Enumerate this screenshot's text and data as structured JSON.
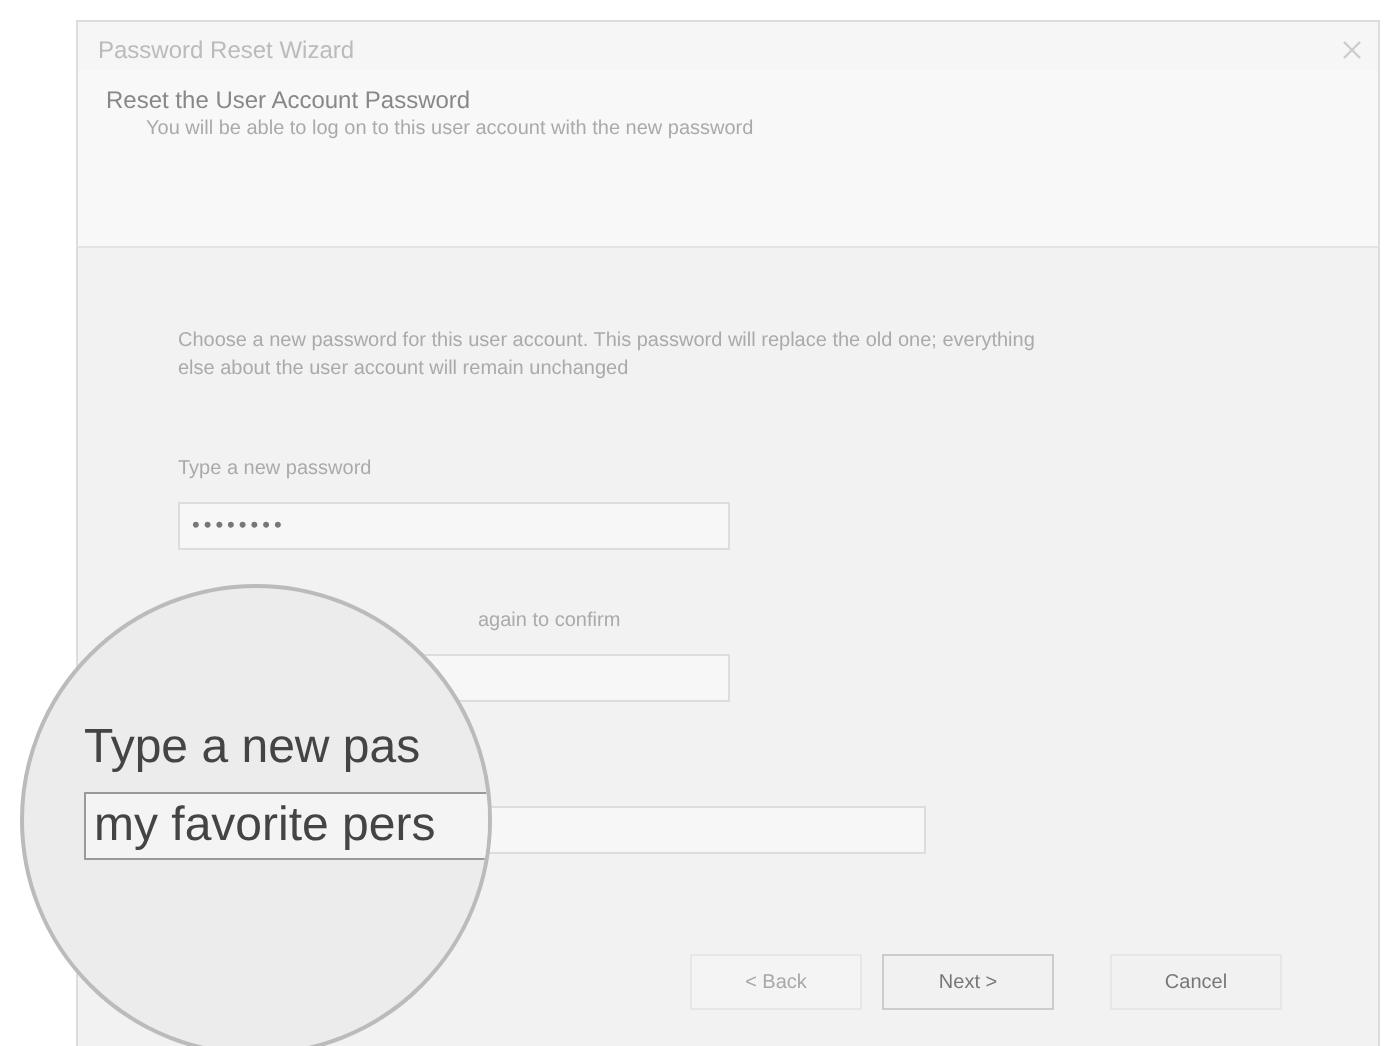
{
  "window": {
    "title": "Password Reset Wizard"
  },
  "header": {
    "title": "Reset the User Account Password",
    "subtitle": "You will be able to log on to this user account with the new password"
  },
  "intro": "Choose a new password for this user account. This password will replace the old one; everything else about the user account will remain unchanged",
  "fields": [
    {
      "label": "Type a new password",
      "value": "••••••••",
      "kind": "short"
    },
    {
      "label": "again to confirm",
      "kind": "short"
    },
    {
      "kind": "long"
    }
  ],
  "magnifier": {
    "label": "Type a new pas",
    "value": "my favorite pers"
  },
  "buttons": [
    {
      "label": "< Back",
      "disabled": true,
      "default": false
    },
    {
      "label": "Next >",
      "disabled": false,
      "default": true
    },
    {
      "label": "Cancel",
      "disabled": false,
      "default": false
    }
  ]
}
